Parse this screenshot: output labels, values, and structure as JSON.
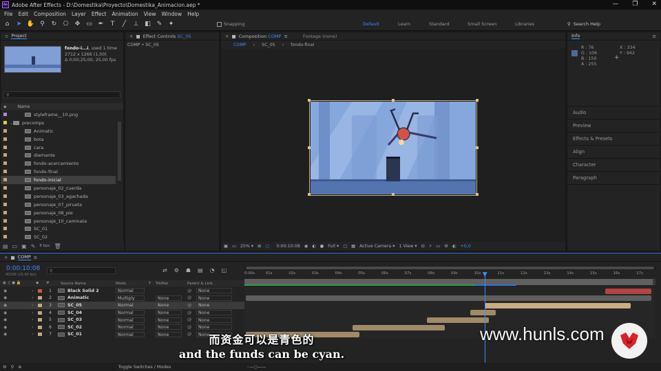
{
  "app": {
    "title": "Adobe After Effects - D:\\Domestika\\Proyecto\\Domestika_Animacion.aep *",
    "logo": "Ae",
    "window_controls": [
      "—",
      "❐",
      "✕"
    ]
  },
  "menu": [
    "File",
    "Edit",
    "Composition",
    "Layer",
    "Effect",
    "Animation",
    "View",
    "Window",
    "Help"
  ],
  "toolbar": {
    "snapping_label": "Snapping",
    "workspaces": [
      "Default",
      "Learn",
      "Standard",
      "Small Screen",
      "Libraries"
    ],
    "active_workspace": "Default",
    "search_help": "Search Help"
  },
  "project": {
    "tab": "Project",
    "thumb_name": "fondo-i...i",
    "thumb_used": ", used 1 time",
    "thumb_dims": "2712 x 1266 (1,00)",
    "thumb_duration": "Δ 0;00;25;00, 25,00 fps",
    "search_placeholder": "",
    "col_name": "Name",
    "items": [
      {
        "name": "styleframe__10.png",
        "type": "file",
        "indent": 1,
        "color": "#a98bd1"
      },
      {
        "name": "precomps",
        "type": "folder",
        "indent": 0,
        "color": "#e3c94a"
      },
      {
        "name": "Animatic",
        "type": "comp",
        "indent": 1,
        "color": "#c4a87a"
      },
      {
        "name": "bota",
        "type": "comp",
        "indent": 1,
        "color": "#c4a87a"
      },
      {
        "name": "cara",
        "type": "comp",
        "indent": 1,
        "color": "#c4a87a"
      },
      {
        "name": "diamante",
        "type": "comp",
        "indent": 1,
        "color": "#c4a87a"
      },
      {
        "name": "fondo-acercamiento",
        "type": "comp",
        "indent": 1,
        "color": "#c4a87a"
      },
      {
        "name": "fondo-final",
        "type": "comp",
        "indent": 1,
        "color": "#c4a87a"
      },
      {
        "name": "fondo-inicial",
        "type": "comp",
        "indent": 1,
        "color": "#c4a87a",
        "selected": true
      },
      {
        "name": "personaje_02_cuerda",
        "type": "comp",
        "indent": 1,
        "color": "#c4a87a"
      },
      {
        "name": "personaje_03_agachada",
        "type": "comp",
        "indent": 1,
        "color": "#c4a87a"
      },
      {
        "name": "personaje_07_pirueta",
        "type": "comp",
        "indent": 1,
        "color": "#c4a87a"
      },
      {
        "name": "personaje_08_pie",
        "type": "comp",
        "indent": 1,
        "color": "#c4a87a"
      },
      {
        "name": "personaje_10_caminata",
        "type": "comp",
        "indent": 1,
        "color": "#c4a87a"
      },
      {
        "name": "SC_01",
        "type": "comp",
        "indent": 1,
        "color": "#c4a87a"
      },
      {
        "name": "SC_02",
        "type": "comp",
        "indent": 1,
        "color": "#c4a87a"
      }
    ],
    "bpc": "8 bpc"
  },
  "effect_controls": {
    "tab_prefix": "Effect Controls",
    "tab_target": "SC_05",
    "breadcrumb": "COMP • SC_05"
  },
  "composition": {
    "tab_prefix": "Composition",
    "tab_target": "COMP",
    "footage_tab": "Footage (none)",
    "crumbs": [
      "COMP",
      "SC_05",
      "fondo-final"
    ],
    "zoom": "25%",
    "timecode": "0:00:10:08",
    "resolution": "Full",
    "camera": "Active Camera",
    "views": "1 View",
    "exposure": "+0,0"
  },
  "info": {
    "tab": "Info",
    "r": "R : 76",
    "g": "G : 106",
    "b": "B : 150",
    "a": "A : 255",
    "x": "X : 334",
    "y": "Y : 942",
    "swatch": "#4c6a96"
  },
  "right_panels": [
    "Audio",
    "Preview",
    "Effects & Presets",
    "Align",
    "Character",
    "Paragraph"
  ],
  "timeline": {
    "tab": "COMP",
    "timecode": "0:00:10:08",
    "fps": "00258 (25.00 fps)",
    "col_source": "Source Name",
    "col_mode": "Mode",
    "col_t": "T",
    "col_trkmat": "TrkMat",
    "col_parent": "Parent & Link",
    "ticks": [
      "0:00s",
      "01s",
      "02s",
      "03s",
      "04s",
      "05s",
      "06s",
      "07s",
      "08s",
      "09s",
      "10s",
      "11s",
      "12s",
      "13s",
      "14s",
      "15s",
      "16s",
      "17s"
    ],
    "playhead_sec": 10.3,
    "layers": [
      {
        "num": "1",
        "name": "Black Solid 2",
        "mode": "Normal",
        "trkmat": "",
        "parent": "None",
        "label": "#d9534f",
        "bar_start": 15.5,
        "bar_end": 17.5,
        "bar_color": "#b24444"
      },
      {
        "num": "2",
        "name": "Animatic",
        "mode": "Multiply",
        "trkmat": "None",
        "parent": "None",
        "label": "#c4a87a",
        "bar_start": 0,
        "bar_end": 17.5,
        "bar_color": "#5e5e5e"
      },
      {
        "num": "3",
        "name": "SC_05",
        "mode": "Normal",
        "trkmat": "None",
        "parent": "None",
        "label": "#c4a87a",
        "selected": true,
        "bar_start": 10.3,
        "bar_end": 16.6,
        "bar_color": "#c9ad82"
      },
      {
        "num": "4",
        "name": "SC_04",
        "mode": "Normal",
        "trkmat": "None",
        "parent": "None",
        "label": "#c4a87a",
        "bar_start": 9.7,
        "bar_end": 10.8,
        "bar_color": "#a08a68"
      },
      {
        "num": "5",
        "name": "SC_03",
        "mode": "Normal",
        "trkmat": "None",
        "parent": "None",
        "label": "#c4a87a",
        "bar_start": 7.8,
        "bar_end": 10.5,
        "bar_color": "#a08a68"
      },
      {
        "num": "6",
        "name": "SC_02",
        "mode": "Normal",
        "trkmat": "None",
        "parent": "None",
        "label": "#c4a87a",
        "bar_start": 4.6,
        "bar_end": 8.6,
        "bar_color": "#a08a68"
      },
      {
        "num": "7",
        "name": "SC_01",
        "mode": "Normal",
        "trkmat": "None",
        "parent": "None",
        "label": "#c4a87a",
        "bar_start": 0,
        "bar_end": 4.9,
        "bar_color": "#a08a68"
      }
    ],
    "footer": "Toggle Switches / Modes"
  },
  "subtitles": {
    "zh": "而资金可以是青色的",
    "en": "and the funds can be cyan."
  },
  "watermark": "www.hunls.com"
}
